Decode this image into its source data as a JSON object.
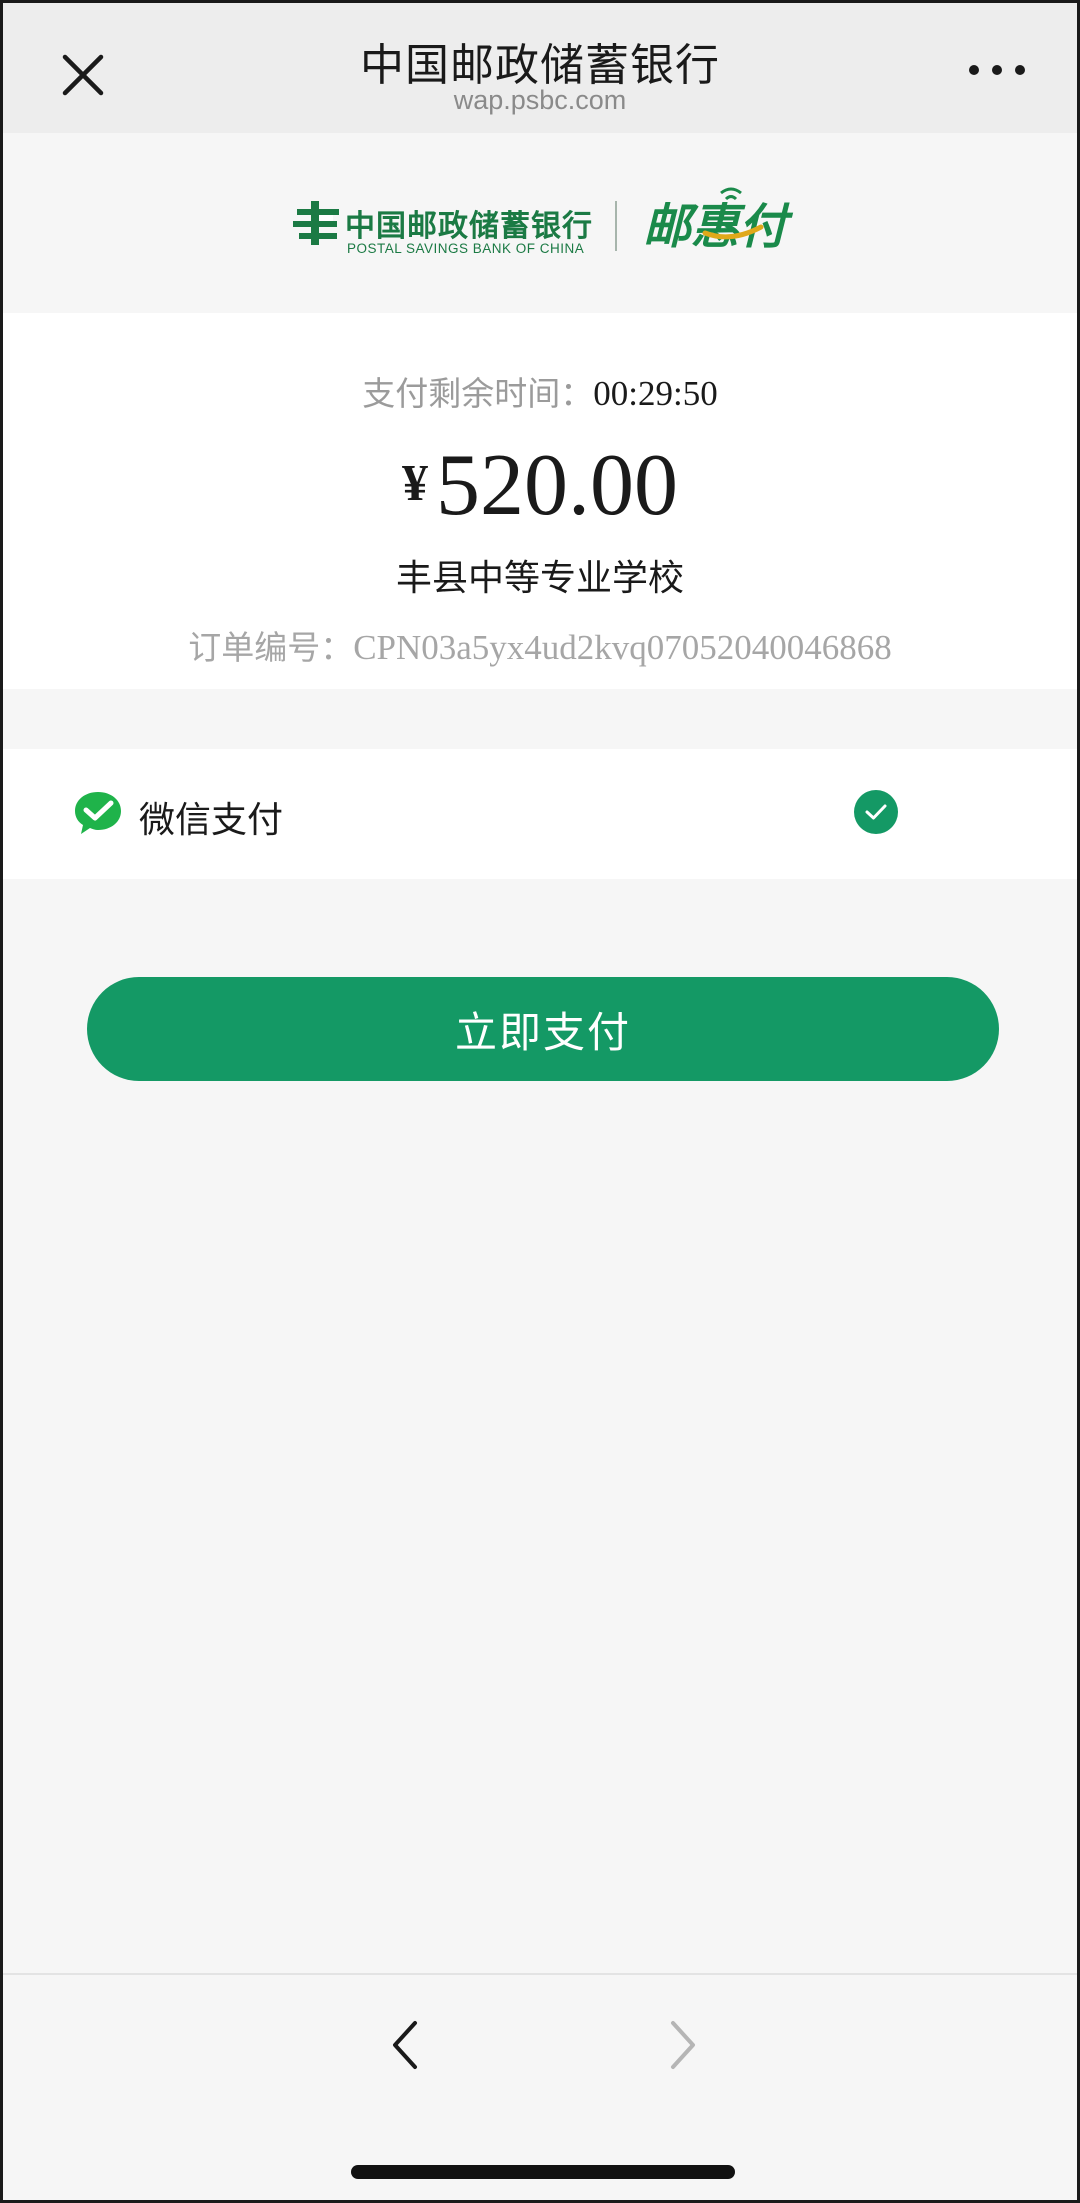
{
  "header": {
    "title": "中国邮政储蓄银行",
    "subtitle": "wap.psbc.com"
  },
  "brand": {
    "name_cn": "中国邮政储蓄银行",
    "name_en": "POSTAL SAVINGS BANK OF CHINA",
    "product": "邮惠付",
    "color": "#1b7a44"
  },
  "payment": {
    "timer_label": "支付剩余时间：",
    "timer_value": "00:29:50",
    "currency_symbol": "¥",
    "amount": "520.00",
    "merchant": "丰县中等专业学校",
    "order_label": "订单编号：",
    "order_number": "CPN03a5yx4ud2kvq07052040046868"
  },
  "method": {
    "label": "微信支付",
    "icon": "wechat-icon",
    "selected": true,
    "accent": "#149965"
  },
  "actions": {
    "pay_label": "立即支付"
  }
}
